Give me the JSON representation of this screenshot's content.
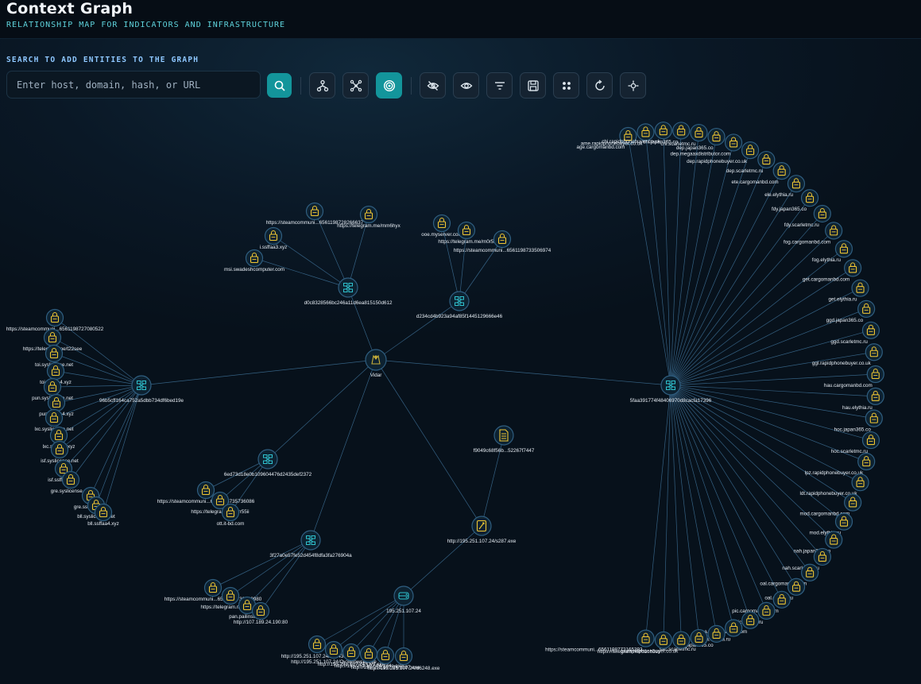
{
  "header": {
    "title": "Context Graph",
    "subtitle": "RELATIONSHIP MAP FOR INDICATORS AND INFRASTRUCTURE"
  },
  "search": {
    "label": "SEARCH TO ADD ENTITIES TO THE GRAPH",
    "placeholder": "Enter host, domain, hash, or URL",
    "value": ""
  },
  "toolbar": [
    {
      "name": "search-button",
      "icon": "search-icon"
    },
    {
      "name": "hierarchy-layout-button",
      "icon": "hierarchy-icon"
    },
    {
      "name": "force-layout-button",
      "icon": "network-icon"
    },
    {
      "name": "radial-layout-button",
      "icon": "target-icon",
      "active": true
    },
    {
      "name": "hide-button",
      "icon": "eye-off-icon"
    },
    {
      "name": "show-button",
      "icon": "eye-icon"
    },
    {
      "name": "filter-button",
      "icon": "filter-icon"
    },
    {
      "name": "export-button",
      "icon": "save-icon"
    },
    {
      "name": "cluster-button",
      "icon": "grid-dots-icon"
    },
    {
      "name": "reset-button",
      "icon": "refresh-icon"
    },
    {
      "name": "center-button",
      "icon": "crosshair-icon"
    }
  ],
  "colors": {
    "edge": "#3d6f95",
    "node_ring": "#2f5e80",
    "node_fill": "#0d2231",
    "host_icon": "#2fc3cf",
    "indicator_icon": "#f1c632",
    "root": "#c9b03a",
    "accent": "#13959b"
  },
  "graph": {
    "nodes": {
      "vidar": {
        "label": "Vidar",
        "type": "root"
      },
      "h1": {
        "label": "d0c8328566bc246a11d6ea815150d612",
        "type": "host"
      },
      "h2": {
        "label": "d234cd4b923a94af85f1445129666e46",
        "type": "host"
      },
      "h3": {
        "label": "96b5cff164ca752a5dbb734df6bed19e",
        "type": "host"
      },
      "h4": {
        "label": "6ed73d18e0b109604476d2435def2372",
        "type": "host"
      },
      "h5": {
        "label": "3f27a0e57fe52d454f8dfa3fa276904a",
        "type": "host"
      },
      "h6": {
        "label": "5faa391774f48406970d8cacfa17396",
        "type": "host"
      },
      "url1": {
        "label": "http://195.251.107.24/s287.exe",
        "type": "exe"
      },
      "file1": {
        "label": "f9049c68f56b...52267f7447",
        "type": "file"
      },
      "ip1": {
        "label": "195.251.107.24",
        "type": "ip"
      }
    },
    "leaves": {
      "h1": [
        "https://steamcommuni...6561198728266637",
        "https://telegram.me/mm6hyx",
        "i.ssffaa3.xyz",
        "msi.swadeshcomputer.com"
      ],
      "h2": [
        "ooe.myserver.com",
        "https://telegram.me/m0r5i",
        "https://steamcommuni...6561198733506974"
      ],
      "h3": [
        "https://steamcommuni...6561198727080522",
        "https://telegram.me/t22see",
        "toi.syslicense.net",
        "toi.ssffaa4.xyz",
        "pun.syslicense.net",
        "pun.ssffaa4.xyz",
        "lxc.syslicense.net",
        "lxc.ssffaa4.xyz",
        "isf.syslicense.net",
        "isf.ssffaa4.xyz",
        "gre.syslicense.net",
        "gre.ssffaa4.xyz",
        "bll.syslicense.net",
        "bll.ssffaa4.xyz"
      ],
      "h4": [
        "https://steamcommuni...6561198735736086",
        "https://telegram.me/grr55ii",
        "ott.it-bd.com"
      ],
      "h5": [
        "https://steamcommuni...6561198732390980",
        "https://telegram.me/k333dr",
        "pan.pailinst.com",
        "http://107.189.24.190:80"
      ],
      "ip1": [
        "http://195.251.107.24/a4343.exe",
        "http://195.251.107.24/Oy3Browser.exe",
        "http://195.251.107.24/Oy3.exe",
        "http://195.251.107.24/2d4s.exe",
        "http://195.251.107.24/s287.exe",
        "http://195.251.107.24/d6248.exe"
      ],
      "h6": [
        "age.cargomanbd.com",
        "ame.rapidphonebuyer.co.uk",
        "chi.rapidphonebuyer.co.uk",
        "chi.japan365.co",
        "chi.scarletmc.ru",
        "dep.japan365.co",
        "dep.megaaxdistributor.com",
        "dep.rapidphonebuyer.co.uk",
        "dep.scarletmc.ru",
        "ete.cargomanbd.com",
        "ele.elythia.ru",
        "fdy.japan365.co",
        "fdy.scarletmc.ru",
        "fog.cargomanbd.com",
        "fog.elythia.ru",
        "get.cargomanbd.com",
        "get.elythia.ru",
        "ggd.japan365.co",
        "ggd.scarletmc.ru",
        "ggl.rapidphonebuyer.co.uk",
        "hau.cargomanbd.com",
        "hau.elythia.ru",
        "hoc.japan365.co",
        "hoc.scarletmc.ru",
        "lpz.rapidphonebuyer.co.uk",
        "ldt.rapidphonebuyer.co.uk",
        "mod.cargomanbd.com",
        "mod.elythia.ru",
        "nah.japan365.co",
        "nah.scarletmc.ru",
        "oal.cargomanbd.com",
        "oal.elythia.ru",
        "pic.cargomanbd.com",
        "pic.elythia.ru",
        "rea.cargomanbd.com",
        "rea.elythia.ru",
        "sac.japan365.co",
        "sac.scarletmc.ru",
        "tui.rapidphonebuyer.co.uk",
        "https://telegram.me/d1ch3ss",
        "https://steamcommuni...6561198772165392"
      ]
    }
  }
}
